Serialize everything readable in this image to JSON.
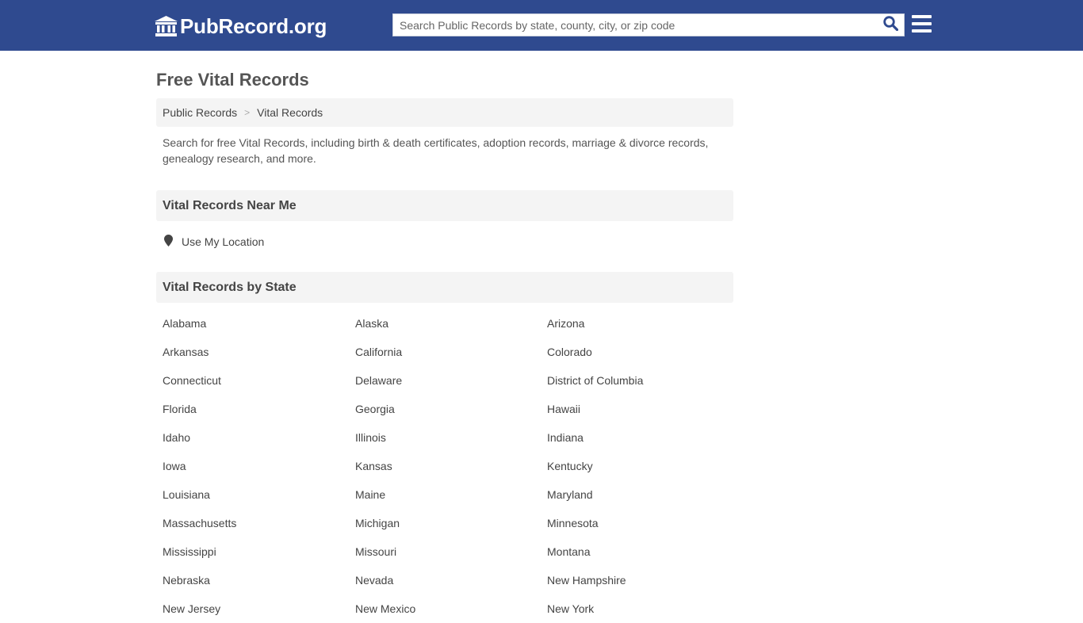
{
  "header": {
    "logo_text": "PubRecord.org",
    "search_placeholder": "Search Public Records by state, county, city, or zip code",
    "search_value": ""
  },
  "page": {
    "title": "Free Vital Records",
    "breadcrumb": [
      "Public Records",
      "Vital Records"
    ],
    "breadcrumb_separator": ">",
    "intro": "Search for free Vital Records, including birth & death certificates, adoption records, marriage & divorce records, genealogy research, and more."
  },
  "near_me": {
    "heading": "Vital Records Near Me",
    "location_link": "Use My Location"
  },
  "by_state": {
    "heading": "Vital Records by State",
    "states": [
      "Alabama",
      "Alaska",
      "Arizona",
      "Arkansas",
      "California",
      "Colorado",
      "Connecticut",
      "Delaware",
      "District of Columbia",
      "Florida",
      "Georgia",
      "Hawaii",
      "Idaho",
      "Illinois",
      "Indiana",
      "Iowa",
      "Kansas",
      "Kentucky",
      "Louisiana",
      "Maine",
      "Maryland",
      "Massachusetts",
      "Michigan",
      "Minnesota",
      "Mississippi",
      "Missouri",
      "Montana",
      "Nebraska",
      "Nevada",
      "New Hampshire",
      "New Jersey",
      "New Mexico",
      "New York"
    ]
  },
  "colors": {
    "header_bg": "#2f4a8f",
    "panel_bg": "#f4f4f4",
    "search_icon": "#2f4a8f"
  },
  "icons": {
    "logo": "courthouse-icon",
    "search": "search-icon",
    "menu": "hamburger-menu-icon",
    "location": "map-pin-icon"
  }
}
